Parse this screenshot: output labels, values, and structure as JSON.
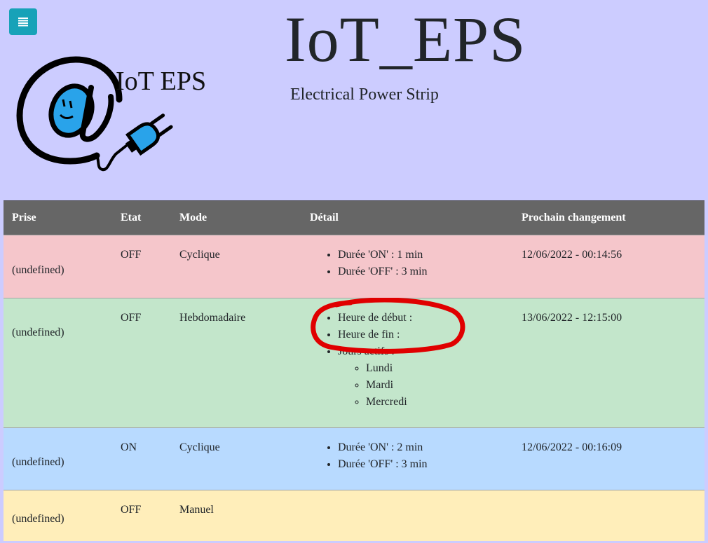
{
  "header": {
    "menu_icon": "hamburger-menu-icon",
    "logo_text": "IoT EPS",
    "title": "IoT_EPS",
    "subtitle": "Electrical Power Strip"
  },
  "colors": {
    "background": "#ccccff",
    "menu_button": "#17a2b8",
    "table_header": "#666666",
    "row_off_cyclic": "#f5c6cb",
    "row_weekly": "#c3e6cb",
    "row_on_cyclic": "#b8daff",
    "row_manual": "#ffeeba",
    "annotation": "#e00000"
  },
  "table": {
    "headers": {
      "prise": "Prise",
      "etat": "Etat",
      "mode": "Mode",
      "detail": "Détail",
      "prochain": "Prochain changement"
    },
    "rows": [
      {
        "prise": "(undefined)",
        "etat": "OFF",
        "mode": "Cyclique",
        "detail": [
          "Durée 'ON' : 1 min",
          "Durée 'OFF' : 3 min"
        ],
        "prochain": "12/06/2022 - 00:14:56"
      },
      {
        "prise": "(undefined)",
        "etat": "OFF",
        "mode": "Hebdomadaire",
        "detail": [
          "Heure de début :",
          "Heure de fin :",
          "Jours actifs :"
        ],
        "days": [
          "Lundi",
          "Mardi",
          "Mercredi"
        ],
        "prochain": "13/06/2022 - 12:15:00"
      },
      {
        "prise": "(undefined)",
        "etat": "ON",
        "mode": "Cyclique",
        "detail": [
          "Durée 'ON' : 2 min",
          "Durée 'OFF' : 3 min"
        ],
        "prochain": "12/06/2022 - 00:16:09"
      },
      {
        "prise": "(undefined)",
        "etat": "OFF",
        "mode": "Manuel",
        "detail": [],
        "prochain": ""
      }
    ]
  }
}
